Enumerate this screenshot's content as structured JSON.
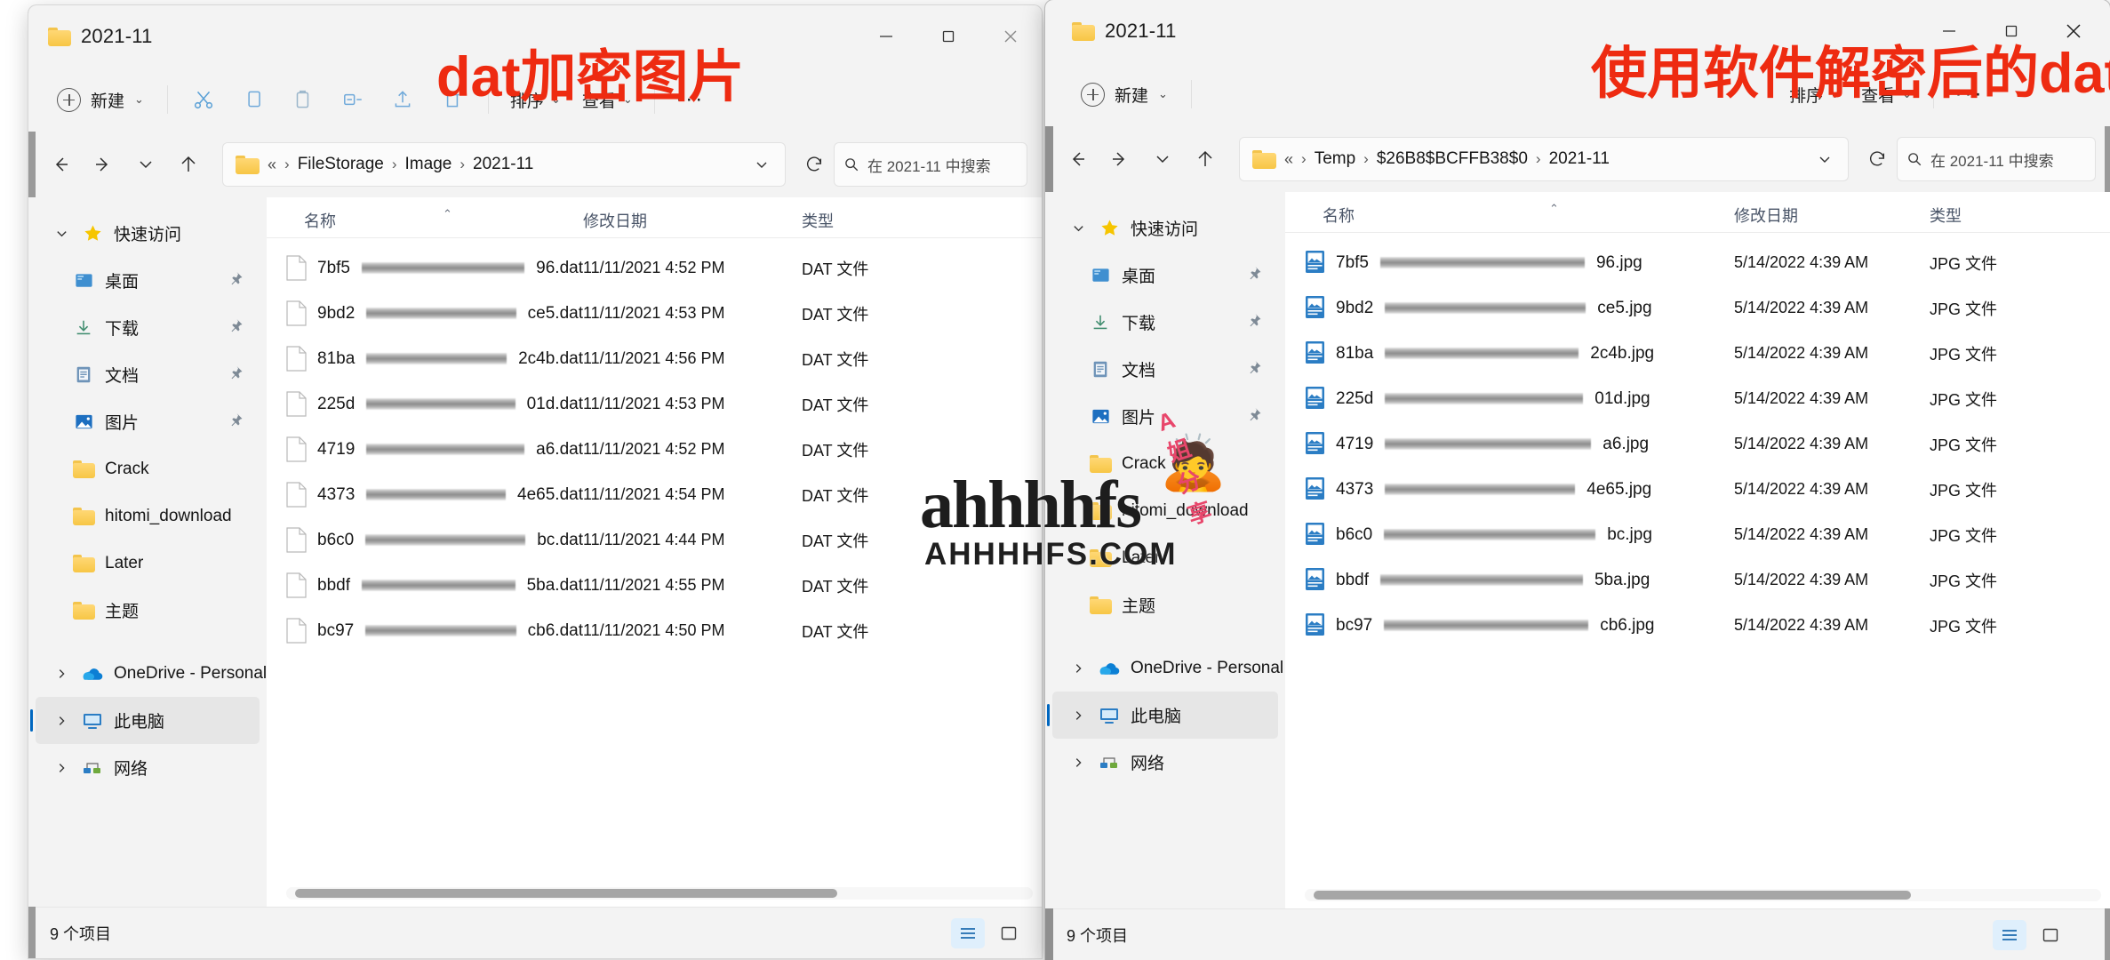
{
  "annotations": {
    "left_overlay": "dat加密图片",
    "right_overlay": "使用软件解密后的dat文件",
    "watermark_text": "ahhhhfs",
    "watermark_sub": "AHHHHFS.COM",
    "watermark_share": "A姐分享",
    "accent_red": "#ee2b11"
  },
  "left_window": {
    "title": "2021-11",
    "controls": {
      "minimize": "最小化",
      "maximize": "最大化",
      "close": "关闭"
    },
    "toolbar": {
      "new_label": "新建",
      "cut_label": "剪切",
      "copy_label": "复制",
      "paste_label": "粘贴",
      "rename_label": "重命名",
      "share_label": "共享",
      "delete_label": "删除",
      "sort_label": "排序",
      "view_label": "查看",
      "more_label": "···"
    },
    "address": {
      "ellipsis": "«",
      "crumbs": [
        "FileStorage",
        "Image",
        "2021-11"
      ],
      "search_placeholder": "在 2021-11 中搜索"
    },
    "nav": {
      "quick_access": "快速访问",
      "items": [
        {
          "label": "桌面",
          "icon": "desktop-icon",
          "pinned": true
        },
        {
          "label": "下载",
          "icon": "downloads-icon",
          "pinned": true
        },
        {
          "label": "文档",
          "icon": "documents-icon",
          "pinned": true
        },
        {
          "label": "图片",
          "icon": "pictures-icon",
          "pinned": true
        },
        {
          "label": "Crack",
          "icon": "folder-icon",
          "pinned": false
        },
        {
          "label": "hitomi_download",
          "icon": "folder-icon",
          "pinned": false
        },
        {
          "label": "Later",
          "icon": "folder-icon",
          "pinned": false
        },
        {
          "label": "主题",
          "icon": "folder-icon",
          "pinned": false
        }
      ],
      "onedrive": "OneDrive - Personal",
      "this_pc": "此电脑",
      "network": "网络"
    },
    "columns": [
      "名称",
      "修改日期",
      "类型"
    ],
    "files": [
      {
        "prefix": "7bf5",
        "suffix": "96.dat",
        "date": "11/11/2021 4:52 PM",
        "type": "DAT 文件"
      },
      {
        "prefix": "9bd2",
        "suffix": "ce5.dat",
        "date": "11/11/2021 4:53 PM",
        "type": "DAT 文件"
      },
      {
        "prefix": "81ba",
        "suffix": "2c4b.dat",
        "date": "11/11/2021 4:56 PM",
        "type": "DAT 文件"
      },
      {
        "prefix": "225d",
        "suffix": "01d.dat",
        "date": "11/11/2021 4:53 PM",
        "type": "DAT 文件"
      },
      {
        "prefix": "4719",
        "suffix": "a6.dat",
        "date": "11/11/2021 4:52 PM",
        "type": "DAT 文件"
      },
      {
        "prefix": "4373",
        "suffix": "4e65.dat",
        "date": "11/11/2021 4:54 PM",
        "type": "DAT 文件"
      },
      {
        "prefix": "b6c0",
        "suffix": "bc.dat",
        "date": "11/11/2021 4:44 PM",
        "type": "DAT 文件"
      },
      {
        "prefix": "bbdf",
        "suffix": "5ba.dat",
        "date": "11/11/2021 4:55 PM",
        "type": "DAT 文件"
      },
      {
        "prefix": "bc97",
        "suffix": "cb6.dat",
        "date": "11/11/2021 4:50 PM",
        "type": "DAT 文件"
      }
    ],
    "status": "9 个项目"
  },
  "right_window": {
    "title": "2021-11",
    "controls": {
      "minimize": "最小化",
      "maximize": "最大化",
      "close": "关闭"
    },
    "toolbar": {
      "new_label": "新建",
      "sort_label": "排序",
      "view_label": "查看",
      "more_label": "···"
    },
    "address": {
      "ellipsis": "«",
      "crumbs": [
        "Temp",
        "$26B8$BCFFB38$0",
        "2021-11"
      ],
      "search_placeholder": "在 2021-11 中搜索"
    },
    "nav": {
      "quick_access": "快速访问",
      "items": [
        {
          "label": "桌面",
          "icon": "desktop-icon",
          "pinned": true
        },
        {
          "label": "下载",
          "icon": "downloads-icon",
          "pinned": true
        },
        {
          "label": "文档",
          "icon": "documents-icon",
          "pinned": true
        },
        {
          "label": "图片",
          "icon": "pictures-icon",
          "pinned": true
        },
        {
          "label": "Crack",
          "icon": "folder-icon",
          "pinned": false
        },
        {
          "label": "hitomi_download",
          "icon": "folder-icon",
          "pinned": false
        },
        {
          "label": "Later",
          "icon": "folder-icon",
          "pinned": false
        },
        {
          "label": "主题",
          "icon": "folder-icon",
          "pinned": false
        }
      ],
      "onedrive": "OneDrive - Personal",
      "this_pc": "此电脑",
      "network": "网络"
    },
    "columns": [
      "名称",
      "修改日期",
      "类型"
    ],
    "files": [
      {
        "prefix": "7bf5",
        "suffix": "96.jpg",
        "date": "5/14/2022 4:39 AM",
        "type": "JPG 文件"
      },
      {
        "prefix": "9bd2",
        "suffix": "ce5.jpg",
        "date": "5/14/2022 4:39 AM",
        "type": "JPG 文件"
      },
      {
        "prefix": "81ba",
        "suffix": "2c4b.jpg",
        "date": "5/14/2022 4:39 AM",
        "type": "JPG 文件"
      },
      {
        "prefix": "225d",
        "suffix": "01d.jpg",
        "date": "5/14/2022 4:39 AM",
        "type": "JPG 文件"
      },
      {
        "prefix": "4719",
        "suffix": "a6.jpg",
        "date": "5/14/2022 4:39 AM",
        "type": "JPG 文件"
      },
      {
        "prefix": "4373",
        "suffix": "4e65.jpg",
        "date": "5/14/2022 4:39 AM",
        "type": "JPG 文件"
      },
      {
        "prefix": "b6c0",
        "suffix": "bc.jpg",
        "date": "5/14/2022 4:39 AM",
        "type": "JPG 文件"
      },
      {
        "prefix": "bbdf",
        "suffix": "5ba.jpg",
        "date": "5/14/2022 4:39 AM",
        "type": "JPG 文件"
      },
      {
        "prefix": "bc97",
        "suffix": "cb6.jpg",
        "date": "5/14/2022 4:39 AM",
        "type": "JPG 文件"
      }
    ],
    "status": "9 个项目"
  }
}
